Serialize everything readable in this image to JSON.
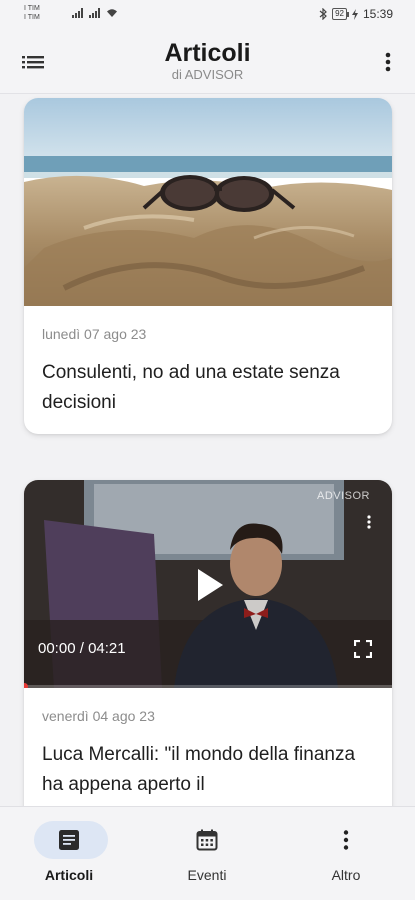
{
  "status_bar": {
    "carrier_1": "I TIM",
    "carrier_2": "I TIM",
    "battery": "92",
    "time": "15:39"
  },
  "app_bar": {
    "title": "Articoli",
    "subtitle": "di ADVISOR",
    "menu_icon": "list-icon",
    "more_icon": "more-vert-icon"
  },
  "articles": [
    {
      "date": "lunedì 07 ago 23",
      "title": "Consulenti, no ad una estate senza decisioni",
      "media": "image",
      "image_desc": "sunglasses-on-sand"
    },
    {
      "date": "venerdì 04 ago 23",
      "title": "Luca Mercalli: \"il mondo della finanza ha appena aperto il",
      "media": "video",
      "video": {
        "current_time": "00:00",
        "separator": "/",
        "duration": "04:21",
        "watermark": "ADVISOR",
        "progress": 0
      }
    }
  ],
  "bottom_nav": {
    "items": [
      {
        "label": "Articoli",
        "icon": "article-icon",
        "active": true
      },
      {
        "label": "Eventi",
        "icon": "calendar-icon",
        "active": false
      },
      {
        "label": "Altro",
        "icon": "more-vert-icon",
        "active": false
      }
    ]
  },
  "colors": {
    "bar_bg": "#f4f4f6",
    "active_pill": "#dde6f4",
    "text_primary": "#1f1f1f",
    "text_secondary": "#8c8c8c"
  }
}
